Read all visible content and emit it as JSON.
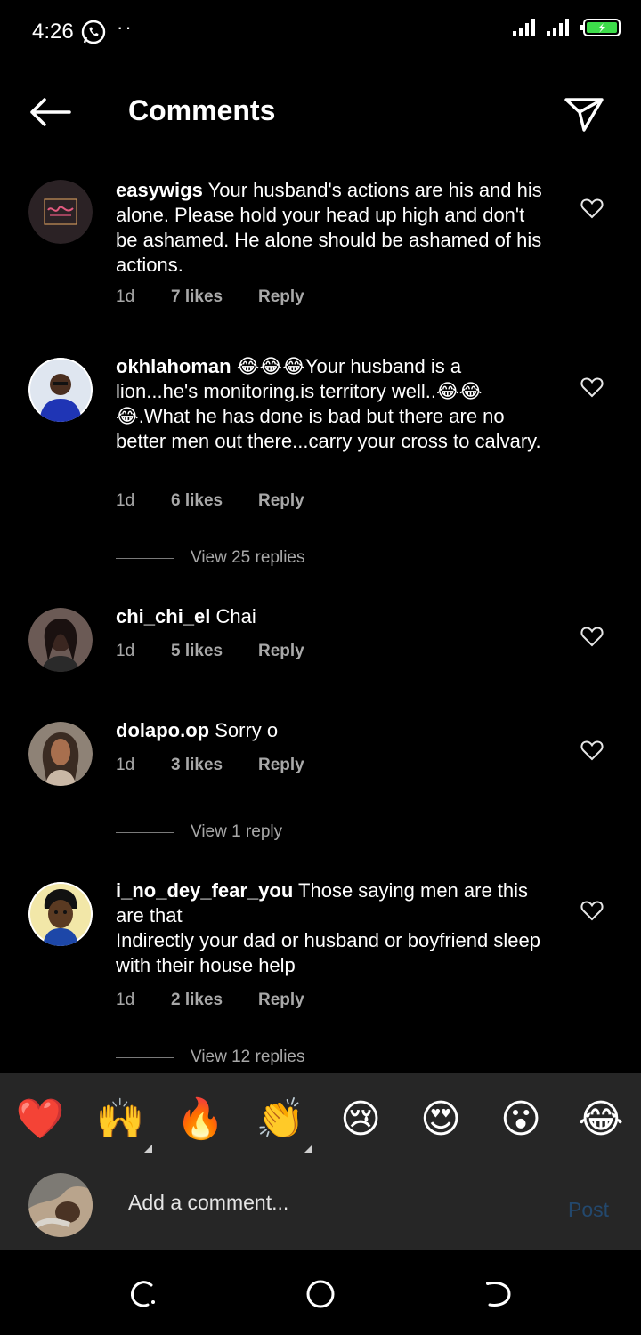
{
  "status_bar": {
    "time": "4:26",
    "dots": "··"
  },
  "header": {
    "title": "Comments"
  },
  "comments": [
    {
      "username": "easywigs",
      "text": "Your husband's actions are his and his alone. Please hold your head up high and don't be ashamed. He alone should be ashamed of his actions.",
      "time": "1d",
      "likes": "7 likes",
      "reply": "Reply"
    },
    {
      "username": "okhlahoman",
      "text": "😂😂😂Your husband is a lion...he's monitoring.is territory well..😂😂😂.What he has done is bad but there are no better men out there...carry your cross to calvary.",
      "time": "1d",
      "likes": "6 likes",
      "reply": "Reply",
      "view_replies": "View 25 replies"
    },
    {
      "username": "chi_chi_el",
      "text": "Chai",
      "time": "1d",
      "likes": "5 likes",
      "reply": "Reply"
    },
    {
      "username": "dolapo.op",
      "text": "Sorry o",
      "time": "1d",
      "likes": "3 likes",
      "reply": "Reply",
      "view_replies": "View 1 reply"
    },
    {
      "username": "i_no_dey_fear_you",
      "text": "Those saying men are this are that\nIndirectly your dad or husband or boyfriend sleep with their house help",
      "time": "1d",
      "likes": "2 likes",
      "reply": "Reply",
      "view_replies": "View 12 replies"
    }
  ],
  "emoji_bar": {
    "emojis": [
      "❤️",
      "🙌",
      "🔥",
      "👏",
      "😢",
      "😍",
      "😮",
      "😂"
    ]
  },
  "composer": {
    "placeholder": "Add a comment...",
    "post_label": "Post"
  },
  "colors": {
    "background": "#000000",
    "panel": "#262626",
    "secondary_text": "#a8a8a8",
    "post_disabled": "#23486d"
  },
  "icons": {
    "status": [
      "whatsapp-icon",
      "signal-icon",
      "battery-icon"
    ],
    "header": [
      "back-arrow-icon",
      "send-icon"
    ],
    "comment": "heart-outline-icon",
    "navbar": [
      "recent-apps-icon",
      "home-icon",
      "back-icon"
    ]
  }
}
